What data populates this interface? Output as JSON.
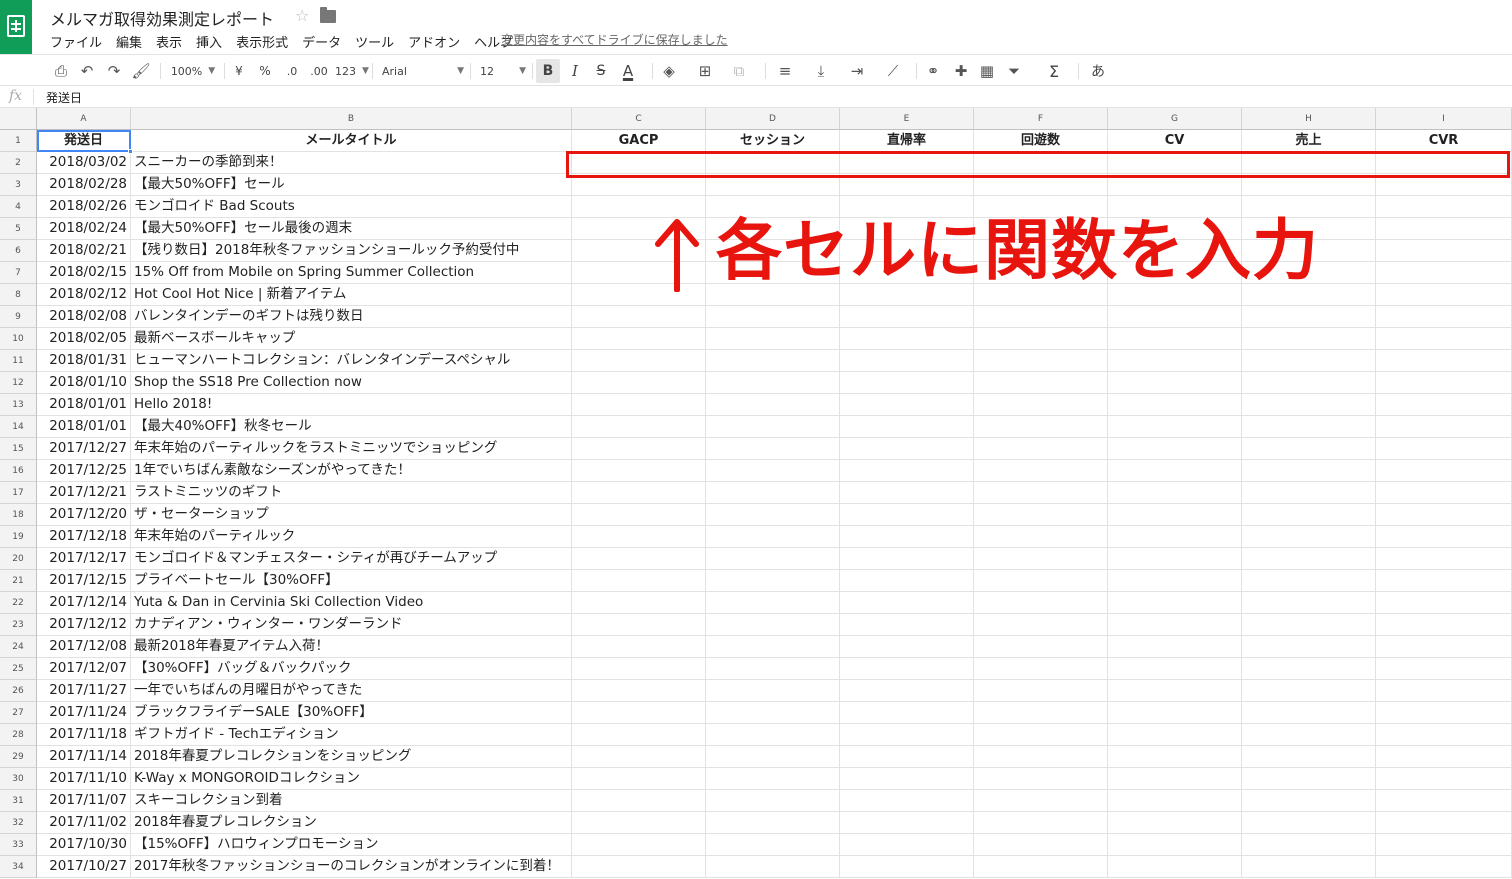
{
  "app": {
    "title": "メルマガ取得効果測定レポート",
    "save_status": "変更内容をすべてドライブに保存しました",
    "star_icon": "star-icon",
    "folder_icon": "folder-icon"
  },
  "menu": [
    "ファイル",
    "編集",
    "表示",
    "挿入",
    "表示形式",
    "データ",
    "ツール",
    "アドオン",
    "ヘルプ"
  ],
  "toolbar": {
    "zoom": "100%",
    "currency": "¥",
    "percent": "%",
    "decimal_dec": ".0",
    "decimal_inc": ".00",
    "number_format": "123",
    "font": "Arial",
    "font_size": "12",
    "bold": "B",
    "italic": "I",
    "strike": "S",
    "text_color": "A",
    "sum": "Σ",
    "input_tool": "あ"
  },
  "formula_bar": {
    "fx": "fx",
    "value": "発送日"
  },
  "columns": [
    "A",
    "B",
    "C",
    "D",
    "E",
    "F",
    "G",
    "H",
    "I"
  ],
  "headers": [
    "発送日",
    "メールタイトル",
    "GACP",
    "セッション",
    "直帰率",
    "回遊数",
    "CV",
    "売上",
    "CVR"
  ],
  "rows": [
    {
      "num": "1"
    },
    {
      "num": "2",
      "date": "2018/03/02",
      "title": "スニーカーの季節到来！"
    },
    {
      "num": "3",
      "date": "2018/02/28",
      "title": "【最大50%OFF】セール"
    },
    {
      "num": "4",
      "date": "2018/02/26",
      "title": "モンゴロイド Bad Scouts"
    },
    {
      "num": "5",
      "date": "2018/02/24",
      "title": "【最大50%OFF】セール最後の週末"
    },
    {
      "num": "6",
      "date": "2018/02/21",
      "title": "【残り数日】2018年秋冬ファッションショールック予約受付中"
    },
    {
      "num": "7",
      "date": "2018/02/15",
      "title": "15% Off from Mobile on Spring Summer Collection"
    },
    {
      "num": "8",
      "date": "2018/02/12",
      "title": "Hot Cool Hot Nice | 新着アイテム"
    },
    {
      "num": "9",
      "date": "2018/02/08",
      "title": "バレンタインデーのギフトは残り数日"
    },
    {
      "num": "10",
      "date": "2018/02/05",
      "title": "最新ベースボールキャップ"
    },
    {
      "num": "11",
      "date": "2018/01/31",
      "title": "ヒューマンハートコレクション：バレンタインデースペシャル"
    },
    {
      "num": "12",
      "date": "2018/01/10",
      "title": "Shop the SS18 Pre Collection now"
    },
    {
      "num": "13",
      "date": "2018/01/01",
      "title": "Hello 2018!"
    },
    {
      "num": "14",
      "date": "2018/01/01",
      "title": "【最大40%OFF】秋冬セール"
    },
    {
      "num": "15",
      "date": "2017/12/27",
      "title": "年末年始のパーティルックをラストミニッツでショッピング"
    },
    {
      "num": "16",
      "date": "2017/12/25",
      "title": "1年でいちばん素敵なシーズンがやってきた！"
    },
    {
      "num": "17",
      "date": "2017/12/21",
      "title": "ラストミニッツのギフト"
    },
    {
      "num": "18",
      "date": "2017/12/20",
      "title": "ザ・セーターショップ"
    },
    {
      "num": "19",
      "date": "2017/12/18",
      "title": "年末年始のパーティルック"
    },
    {
      "num": "20",
      "date": "2017/12/17",
      "title": "モンゴロイド＆マンチェスター・シティが再びチームアップ"
    },
    {
      "num": "21",
      "date": "2017/12/15",
      "title": "プライベートセール【30%OFF】"
    },
    {
      "num": "22",
      "date": "2017/12/14",
      "title": "Yuta & Dan in Cervinia Ski Collection Video"
    },
    {
      "num": "23",
      "date": "2017/12/12",
      "title": "カナディアン・ウィンター・ワンダーランド"
    },
    {
      "num": "24",
      "date": "2017/12/08",
      "title": "最新2018年春夏アイテム入荷！"
    },
    {
      "num": "25",
      "date": "2017/12/07",
      "title": "【30%OFF】バッグ＆バックパック"
    },
    {
      "num": "26",
      "date": "2017/11/27",
      "title": "一年でいちばんの月曜日がやってきた"
    },
    {
      "num": "27",
      "date": "2017/11/24",
      "title": "ブラックフライデーSALE【30%OFF】"
    },
    {
      "num": "28",
      "date": "2017/11/18",
      "title": "ギフトガイド - Techエディション"
    },
    {
      "num": "29",
      "date": "2017/11/14",
      "title": "2018年春夏プレコレクションをショッピング"
    },
    {
      "num": "30",
      "date": "2017/11/10",
      "title": "K-Way x MONGOROIDコレクション"
    },
    {
      "num": "31",
      "date": "2017/11/07",
      "title": "スキーコレクション到着"
    },
    {
      "num": "32",
      "date": "2017/11/02",
      "title": "2018年春夏プレコレクション"
    },
    {
      "num": "33",
      "date": "2017/10/30",
      "title": "【15%OFF】ハロウィンプロモーション"
    },
    {
      "num": "34",
      "date": "2017/10/27",
      "title": "2017年秋冬ファッションショーのコレクションがオンラインに到着！"
    }
  ],
  "annotation": {
    "text": "各セルに関数を入力",
    "color": "#e8150f"
  },
  "colors": {
    "app_green": "#0f9d58",
    "selection_blue": "#4285f4",
    "annotation_red": "#e8150f"
  }
}
